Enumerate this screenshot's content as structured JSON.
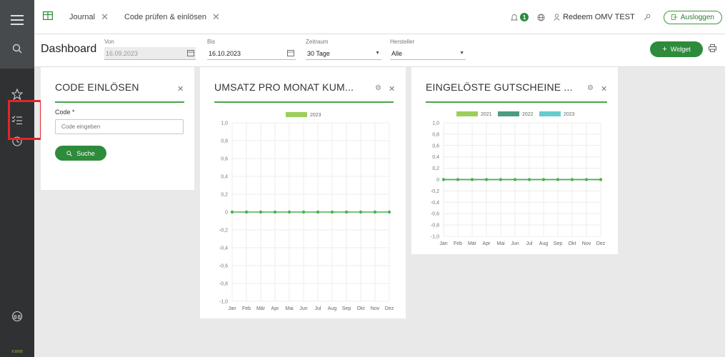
{
  "tabs": [
    {
      "label": "Journal"
    },
    {
      "label": "Code prüfen & einlösen"
    }
  ],
  "header": {
    "notification_count": "1",
    "user_name": "Redeem OMV TEST",
    "logout_label": "Ausloggen"
  },
  "filter": {
    "title": "Dashboard",
    "von_label": "Von",
    "von_value": "16.09.2023",
    "bis_label": "Bis",
    "bis_value": "16.10.2023",
    "zeitraum_label": "Zeitraum",
    "zeitraum_value": "30 Tage",
    "hersteller_label": "Hersteller",
    "hersteller_value": "Alle",
    "widget_label": "Widget"
  },
  "sidebar": {
    "version": "9.9999"
  },
  "code_card": {
    "title": "CODE EINLÖSEN",
    "code_label": "Code *",
    "code_placeholder": "Code eingeben",
    "search_label": "Suche"
  },
  "colors": {
    "accent": "#2e8b3c",
    "sidebar_bg": "#2f3133",
    "highlight": "#e0262b",
    "series_2021": "#8cc63f",
    "series_2022": "#2e8b6c",
    "series_2023_teal": "#4cc3c3"
  },
  "chart_data": [
    {
      "type": "line",
      "title": "UMSATZ PRO MONAT KUM...",
      "categories": [
        "Jan",
        "Feb",
        "Mär",
        "Apr",
        "Mai",
        "Jun",
        "Jul",
        "Aug",
        "Sep",
        "Okt",
        "Nov",
        "Dez"
      ],
      "series": [
        {
          "name": "2023",
          "color": "#8cc63f",
          "values": [
            0,
            0,
            0,
            0,
            0,
            0,
            0,
            0,
            0,
            0,
            0,
            0
          ]
        }
      ],
      "yticks": [
        "1,0",
        "0,8",
        "0,6",
        "0,4",
        "0,2",
        "0",
        "-0,2",
        "-0,4",
        "-0,6",
        "-0,8",
        "-1,0"
      ],
      "ylim": [
        -1,
        1
      ],
      "grid": true,
      "legend": "top"
    },
    {
      "type": "line",
      "title": "EINGELÖSTE GUTSCHEINE ...",
      "categories": [
        "Jan",
        "Feb",
        "Mär",
        "Apr",
        "Mai",
        "Jun",
        "Jul",
        "Aug",
        "Sep",
        "Okt",
        "Nov",
        "Dez"
      ],
      "series": [
        {
          "name": "2021",
          "color": "#8cc63f",
          "values": [
            0,
            0,
            0,
            0,
            0,
            0,
            0,
            0,
            0,
            0,
            0,
            0
          ]
        },
        {
          "name": "2022",
          "color": "#2e8b6c",
          "values": [
            0,
            0,
            0,
            0,
            0,
            0,
            0,
            0,
            0,
            0,
            0,
            0
          ]
        },
        {
          "name": "2023",
          "color": "#4cc3c3",
          "values": [
            0,
            0,
            0,
            0,
            0,
            0,
            0,
            0,
            0,
            0,
            0,
            0
          ]
        }
      ],
      "yticks": [
        "1,0",
        "0,8",
        "0,6",
        "0,4",
        "0,2",
        "0",
        "-0,2",
        "-0,4",
        "-0,6",
        "-0,8",
        "-1,0"
      ],
      "ylim": [
        -1,
        1
      ],
      "grid": true,
      "legend": "top"
    }
  ]
}
